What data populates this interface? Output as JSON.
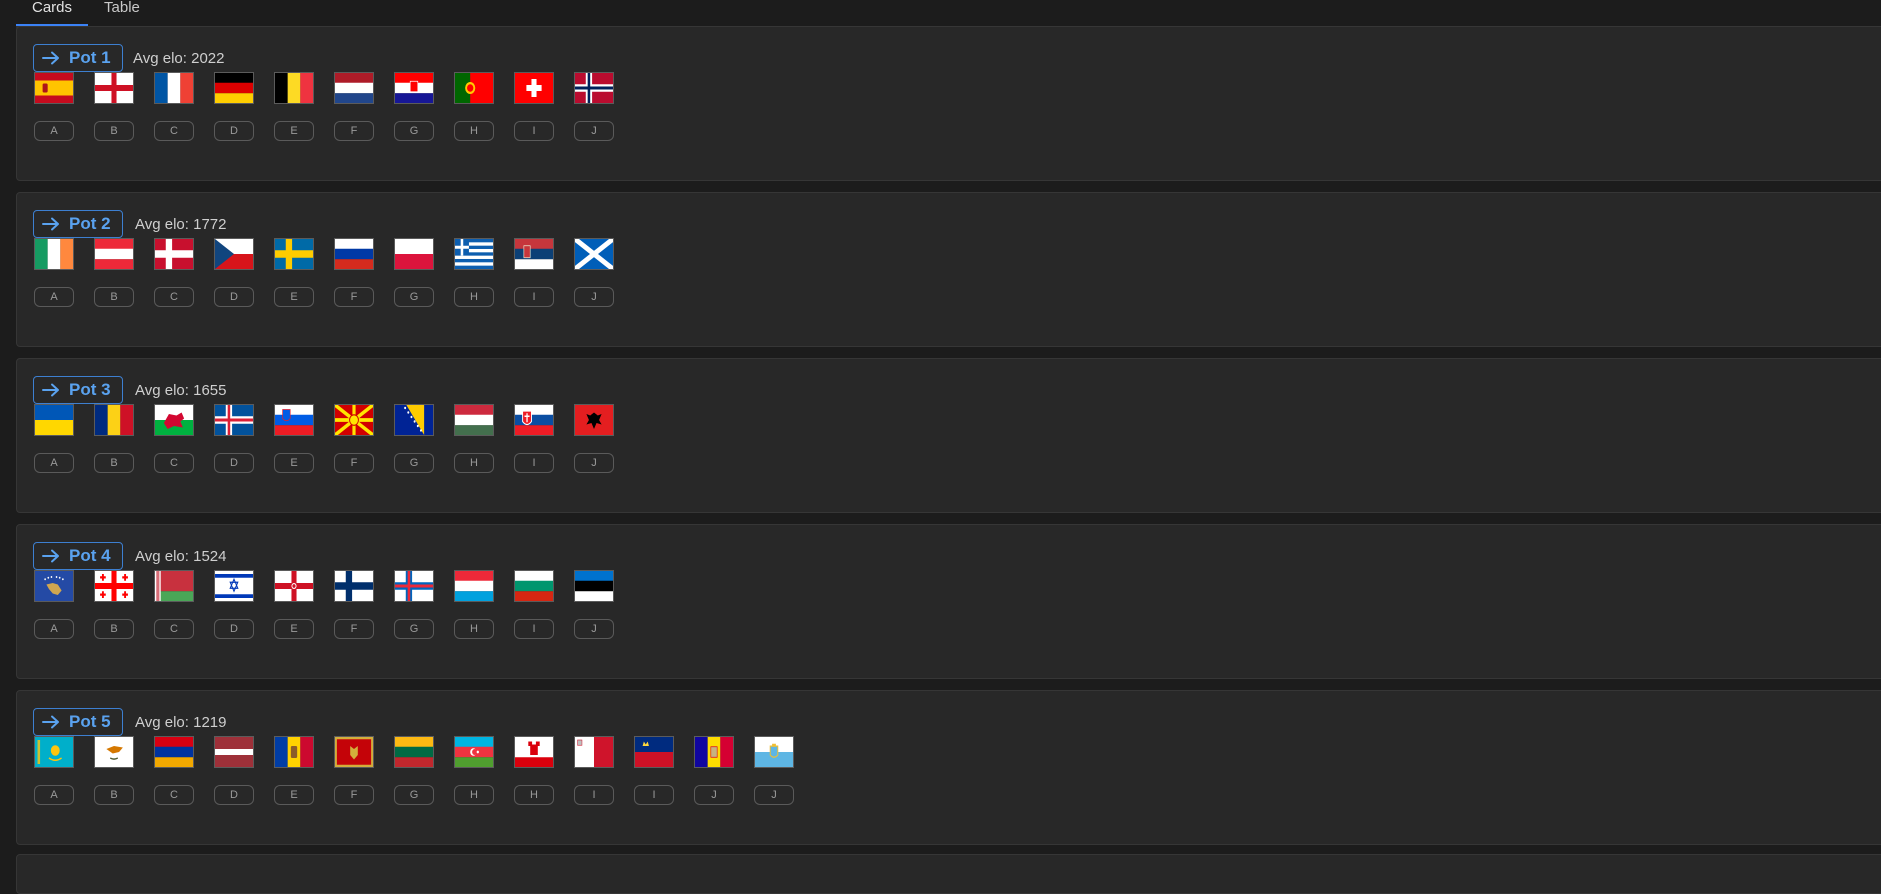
{
  "tabs": [
    {
      "label": "Cards",
      "active": true
    },
    {
      "label": "Table",
      "active": false
    }
  ],
  "colors": {
    "accent": "#3b82f6",
    "pot_button": "#5aa2ef",
    "card_bg": "#282828",
    "page_bg": "#1c1c1c"
  },
  "pots": [
    {
      "name": "Pot 1",
      "avg": "Avg elo: 2022",
      "teams": [
        {
          "flag": "spain",
          "group": "A"
        },
        {
          "flag": "england",
          "group": "B"
        },
        {
          "flag": "france",
          "group": "C"
        },
        {
          "flag": "germany",
          "group": "D"
        },
        {
          "flag": "belgium",
          "group": "E"
        },
        {
          "flag": "netherlands",
          "group": "F"
        },
        {
          "flag": "croatia",
          "group": "G"
        },
        {
          "flag": "portugal",
          "group": "H"
        },
        {
          "flag": "switzerland",
          "group": "I"
        },
        {
          "flag": "norway",
          "group": "J"
        }
      ]
    },
    {
      "name": "Pot 2",
      "avg": "Avg elo: 1772",
      "teams": [
        {
          "flag": "ireland",
          "group": "A"
        },
        {
          "flag": "austria",
          "group": "B"
        },
        {
          "flag": "denmark",
          "group": "C"
        },
        {
          "flag": "czechia",
          "group": "D"
        },
        {
          "flag": "sweden",
          "group": "E"
        },
        {
          "flag": "russia",
          "group": "F"
        },
        {
          "flag": "poland",
          "group": "G"
        },
        {
          "flag": "greece",
          "group": "H"
        },
        {
          "flag": "serbia",
          "group": "I"
        },
        {
          "flag": "scotland",
          "group": "J"
        }
      ]
    },
    {
      "name": "Pot 3",
      "avg": "Avg elo: 1655",
      "teams": [
        {
          "flag": "ukraine",
          "group": "A"
        },
        {
          "flag": "romania",
          "group": "B"
        },
        {
          "flag": "wales",
          "group": "C"
        },
        {
          "flag": "iceland",
          "group": "D"
        },
        {
          "flag": "slovenia",
          "group": "E"
        },
        {
          "flag": "north-macedonia",
          "group": "F"
        },
        {
          "flag": "bosnia",
          "group": "G"
        },
        {
          "flag": "hungary",
          "group": "H"
        },
        {
          "flag": "slovakia",
          "group": "I"
        },
        {
          "flag": "albania",
          "group": "J"
        }
      ]
    },
    {
      "name": "Pot 4",
      "avg": "Avg elo: 1524",
      "teams": [
        {
          "flag": "kosovo",
          "group": "A"
        },
        {
          "flag": "georgia",
          "group": "B"
        },
        {
          "flag": "belarus",
          "group": "C"
        },
        {
          "flag": "israel",
          "group": "D"
        },
        {
          "flag": "northern-ireland",
          "group": "E"
        },
        {
          "flag": "finland",
          "group": "F"
        },
        {
          "flag": "faroe-islands",
          "group": "G"
        },
        {
          "flag": "luxembourg",
          "group": "H"
        },
        {
          "flag": "bulgaria",
          "group": "I"
        },
        {
          "flag": "estonia",
          "group": "J"
        }
      ]
    },
    {
      "name": "Pot 5",
      "avg": "Avg elo: 1219",
      "teams": [
        {
          "flag": "kazakhstan",
          "group": "A"
        },
        {
          "flag": "cyprus",
          "group": "B"
        },
        {
          "flag": "armenia",
          "group": "C"
        },
        {
          "flag": "latvia",
          "group": "D"
        },
        {
          "flag": "moldova",
          "group": "E"
        },
        {
          "flag": "montenegro",
          "group": "F"
        },
        {
          "flag": "lithuania",
          "group": "G"
        },
        {
          "flag": "azerbaijan",
          "group": "H"
        },
        {
          "flag": "gibraltar",
          "group": "H"
        },
        {
          "flag": "malta",
          "group": "I"
        },
        {
          "flag": "liechtenstein",
          "group": "I"
        },
        {
          "flag": "andorra",
          "group": "J"
        },
        {
          "flag": "san-marino",
          "group": "J"
        }
      ]
    }
  ]
}
